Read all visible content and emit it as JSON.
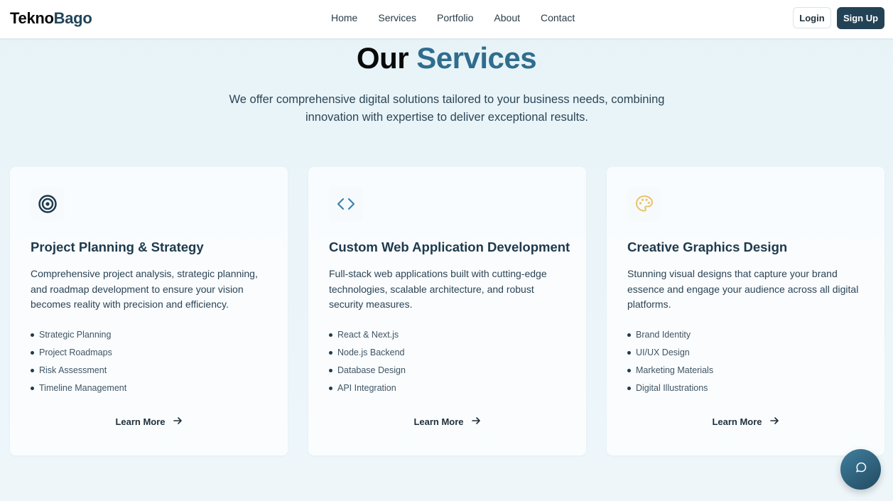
{
  "brand": {
    "part1": "Tekno",
    "part2": "Bago"
  },
  "nav": {
    "links": [
      "Home",
      "Services",
      "Portfolio",
      "About",
      "Contact"
    ]
  },
  "auth": {
    "login": "Login",
    "signup": "Sign Up"
  },
  "heading": {
    "part1": "Our",
    "part2": "Services"
  },
  "subtitle": "We offer comprehensive digital solutions tailored to your business needs, combining innovation with expertise to deliver exceptional results.",
  "cards": [
    {
      "icon": "target-icon",
      "icon_color": "#1f3b4d",
      "title": "Project Planning & Strategy",
      "description": "Comprehensive project analysis, strategic planning, and roadmap development to ensure your vision becomes reality with precision and efficiency.",
      "features": [
        "Strategic Planning",
        "Project Roadmaps",
        "Risk Assessment",
        "Timeline Management"
      ],
      "cta": "Learn More"
    },
    {
      "icon": "code-icon",
      "icon_color": "#3a84b0",
      "title": "Custom Web Application Development",
      "description": "Full-stack web applications built with cutting-edge technologies, scalable architecture, and robust security measures.",
      "features": [
        "React & Next.js",
        "Node.js Backend",
        "Database Design",
        "API Integration"
      ],
      "cta": "Learn More"
    },
    {
      "icon": "palette-icon",
      "icon_color": "#e8c46a",
      "title": "Creative Graphics Design",
      "description": "Stunning visual designs that capture your brand essence and engage your audience across all digital platforms.",
      "features": [
        "Brand Identity",
        "UI/UX Design",
        "Marketing Materials",
        "Digital Illustrations"
      ],
      "cta": "Learn More"
    }
  ],
  "chat": {
    "icon": "chat-icon"
  }
}
